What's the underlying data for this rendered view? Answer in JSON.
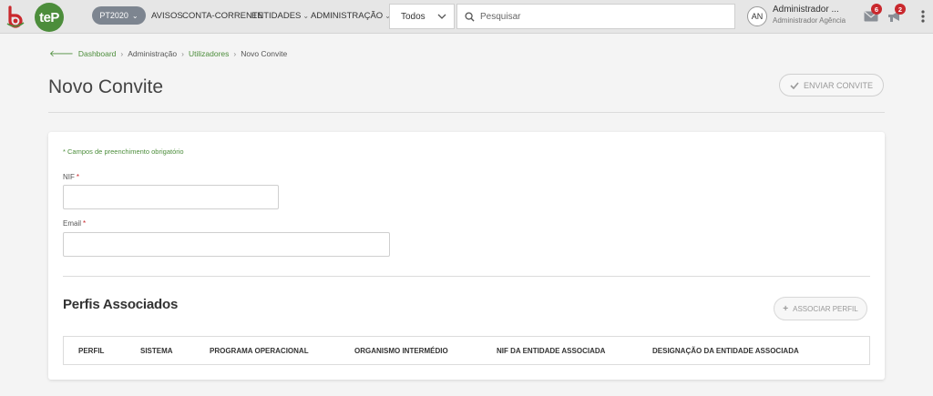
{
  "header": {
    "context_pill": "PT2020",
    "nav": [
      "AVISOS",
      "CONTA-CORRENTE",
      "ENTIDADES",
      "ADMINISTRAÇÃO"
    ],
    "filter_value": "Todos",
    "search_placeholder": "Pesquisar",
    "user": {
      "initials": "AN",
      "name": "Administrador ...",
      "role": "Administrador Agência"
    },
    "messages_count": "6",
    "notifications_count": "2",
    "icons": {
      "messages": "envelope-icon",
      "notifications": "megaphone-icon",
      "menu": "kebab-icon",
      "search": "search-icon"
    },
    "brand_logo": "teP"
  },
  "breadcrumb": {
    "items": [
      "Dashboard",
      "Administração",
      "Utilizadores",
      "Novo Convite"
    ]
  },
  "page": {
    "title": "Novo Convite",
    "send_button": "ENVIAR CONVITE"
  },
  "form": {
    "required_note": "* Campos de preenchimento obrigatório",
    "nif_label": "NIF",
    "email_label": "Email",
    "required_marker": "*",
    "nif_value": "",
    "email_value": ""
  },
  "profiles": {
    "title": "Perfis Associados",
    "add_button": "ASSOCIAR PERFIL",
    "columns": [
      "PERFIL",
      "SISTEMA",
      "PROGRAMA OPERACIONAL",
      "ORGANISMO INTERMÉDIO",
      "NIF DA ENTIDADE ASSOCIADA",
      "DESIGNAÇÃO DA ENTIDADE ASSOCIADA"
    ]
  },
  "colors": {
    "brand_green": "#4c8d3b",
    "badge_red": "#c9282d",
    "pill_gray": "#7d8590"
  }
}
